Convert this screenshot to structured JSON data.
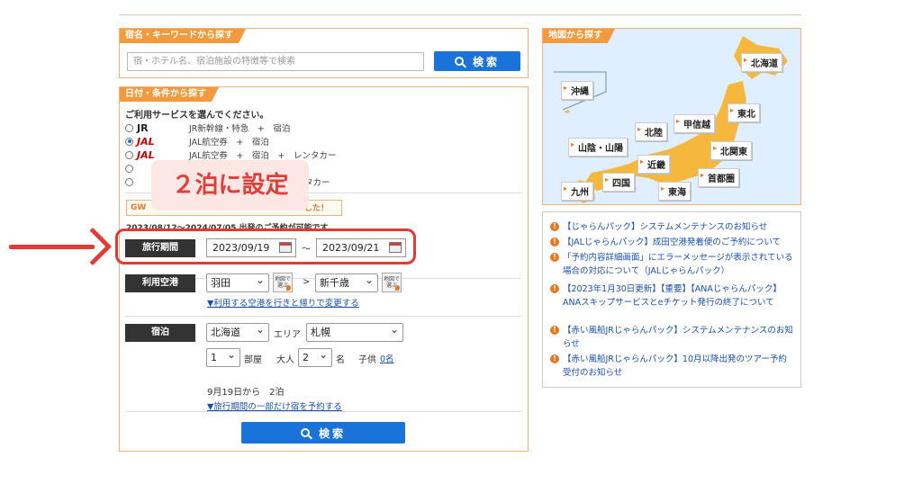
{
  "keyword": {
    "tab": "宿名・キーワードから探す",
    "placeholder": "宿・ホテル名、宿泊施設の特徴等で検索",
    "search_label": "検索"
  },
  "conditions": {
    "tab": "日付・条件から探す",
    "service_title": "ご利用サービスを選んでください。",
    "services": [
      {
        "logo": "JR",
        "text": "JR新幹線・特急　+　宿泊",
        "selected": false
      },
      {
        "logo": "JAL",
        "text": "JAL航空券　+　宿泊",
        "selected": true
      },
      {
        "logo": "JAL",
        "text": "JAL航空券　+　宿泊　+　レンタカー",
        "selected": false
      },
      {
        "logo": "",
        "text": "",
        "selected": false
      },
      {
        "logo": "",
        "text": "タカー",
        "selected": false
      }
    ],
    "callout": "２泊に設定",
    "notice": "GW",
    "notice_end": "した！",
    "note": "2023/08/12～2024/07/05 出発のご予約が可能です",
    "period_label": "旅行期間",
    "date_from": "2023/09/19",
    "tilde": "～",
    "date_to": "2023/09/21",
    "airport_label": "利用空港",
    "airport_from": "羽田",
    "map_btn": "地図で選ぶ",
    "arrow_sep": ">",
    "airport_to": "新千歳",
    "airport_link": "▼利用する空港を行きと帰りで変更する",
    "stay_label": "宿泊",
    "pref": "北海道",
    "area_label": "エリア",
    "area": "札幌",
    "rooms": "1",
    "rooms_unit": "部屋",
    "adult_label": "大人",
    "adults": "2",
    "adult_unit": "名",
    "child_label": "子供",
    "child_link": "0名",
    "stay_summary": "9月19日から　2泊",
    "partial_link": "▼旅行期間の一部だけ宿を予約する",
    "search_label": "検索"
  },
  "map": {
    "tab": "地図から探す",
    "regions": [
      "北海道",
      "沖縄",
      "東北",
      "甲信越",
      "北陸",
      "山陰・山陽",
      "北関東",
      "近畿",
      "首都圏",
      "九州",
      "四国",
      "東海"
    ]
  },
  "news": [
    "【じゃらんパック】システムメンテナンスのお知らせ",
    "【JALじゃらんパック】成田空港発着便のご予約について",
    "「予約内容詳細画面」にエラーメッセージが表示されている場合の対応について（JALじゃらんパック）",
    "【2023年1月30日更新】【重要】【ANAじゃらんパック】ANAスキップサービスとeチケット発行の終了について",
    "【赤い風船JRじゃらんパック】システムメンテナンスのお知らせ",
    "【赤い風船JRじゃらんパック】10月以降出発のツアー予約受付のお知らせ"
  ],
  "colors": {
    "accent": "#f39a3d",
    "button": "#1a73d9",
    "annotation": "#e53935"
  }
}
